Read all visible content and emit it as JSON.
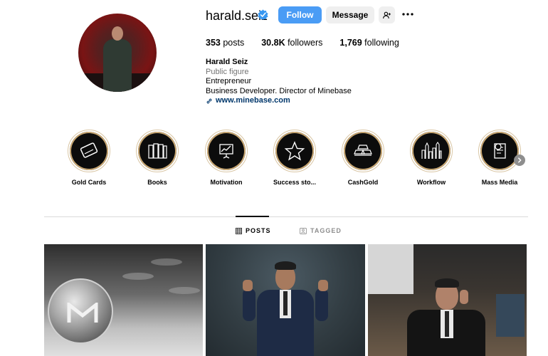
{
  "profile": {
    "username": "harald.seiz",
    "follow_label": "Follow",
    "message_label": "Message",
    "posts_count": "353",
    "posts_label": "posts",
    "followers_count": "30.8K",
    "followers_label": "followers",
    "following_count": "1,769",
    "following_label": "following",
    "full_name": "Harald Seiz",
    "category": "Public figure",
    "bio_line1": "Entrepreneur",
    "bio_line2": "Business Developer. Director of Minebase",
    "link": "www.minebase.com"
  },
  "highlights": [
    {
      "label": "Gold Cards",
      "icon": "card-icon"
    },
    {
      "label": "Books",
      "icon": "books-icon"
    },
    {
      "label": "Motivation",
      "icon": "presentation-icon"
    },
    {
      "label": "Success sto...",
      "icon": "star-icon"
    },
    {
      "label": "CashGold",
      "icon": "gold-bars-icon"
    },
    {
      "label": "Workflow",
      "icon": "skyline-icon"
    },
    {
      "label": "Mass Media",
      "icon": "document-icon"
    }
  ],
  "tabs": {
    "posts": "POSTS",
    "tagged": "TAGGED"
  },
  "colors": {
    "follow_button": "#4a9cf5",
    "secondary_button": "#efefef",
    "link": "#00376b",
    "muted": "#737373",
    "highlight_ring": "#c9a874"
  }
}
